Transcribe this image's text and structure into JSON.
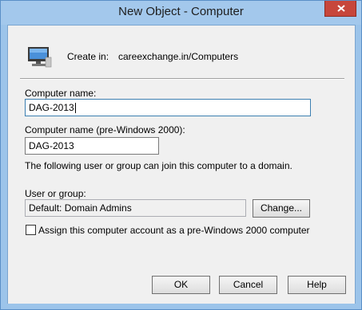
{
  "window": {
    "title": "New Object - Computer"
  },
  "header": {
    "icon": "computer-icon",
    "create_in_label": "Create in:",
    "create_in_path": "careexchange.in/Computers"
  },
  "form": {
    "computer_name_label": "Computer name:",
    "computer_name_value": "DAG-2013",
    "pre2000_label": "Computer name (pre-Windows 2000):",
    "pre2000_value": "DAG-2013",
    "join_info": "The following user or group can join this computer to a domain.",
    "user_group_label": "User or group:",
    "user_group_value": "Default: Domain Admins",
    "change_button": "Change...",
    "checkbox_label": "Assign this computer account as a pre-Windows 2000 computer",
    "checkbox_checked": false
  },
  "buttons": {
    "ok": "OK",
    "cancel": "Cancel",
    "help": "Help"
  }
}
